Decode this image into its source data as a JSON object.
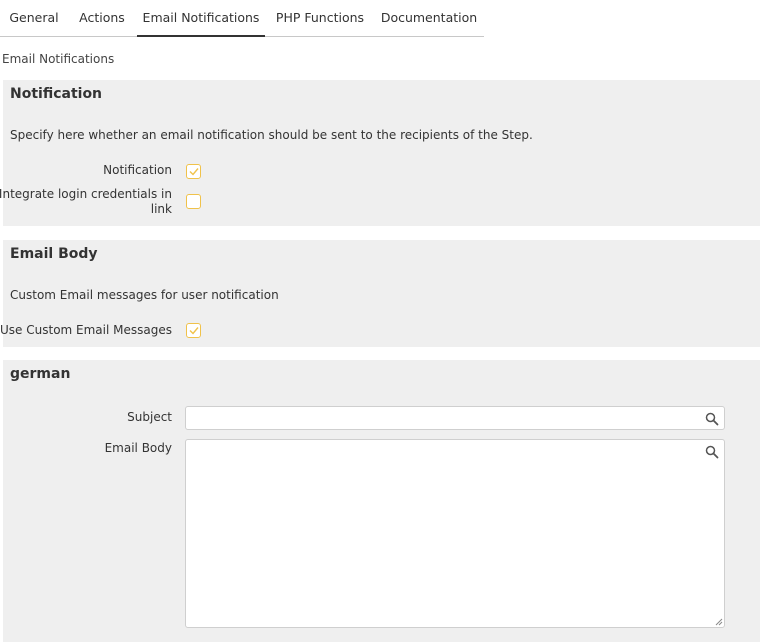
{
  "tabs": [
    {
      "label": "General",
      "active": false
    },
    {
      "label": "Actions",
      "active": false
    },
    {
      "label": "Email Notifications",
      "active": true
    },
    {
      "label": "PHP Functions",
      "active": false
    },
    {
      "label": "Documentation",
      "active": false
    }
  ],
  "breadcrumb": "Email Notifications",
  "notification_panel": {
    "title": "Notification",
    "description": "Specify here whether an email notification should be sent to the recipients of the Step.",
    "fields": {
      "notification_label": "Notification",
      "notification_checked": true,
      "integrate_label_line1": "Integrate login credentials in",
      "integrate_label_line2": "link",
      "integrate_checked": false
    }
  },
  "email_body_panel": {
    "title": "Email Body",
    "description": "Custom Email messages for user notification",
    "fields": {
      "custom_label": "Use Custom Email Messages",
      "custom_checked": true
    }
  },
  "german_panel": {
    "title": "german",
    "subject_label": "Subject",
    "subject_value": "",
    "body_label": "Email Body",
    "body_value": ""
  },
  "colors": {
    "panel_bg": "#efefef",
    "checkbox_border": "#f0c24a",
    "checkmark": "#f0c24a",
    "tab_active_underline": "#333333"
  },
  "icons": {
    "search": "search-icon",
    "check": "check-icon",
    "resize": "resize-handle-icon"
  }
}
